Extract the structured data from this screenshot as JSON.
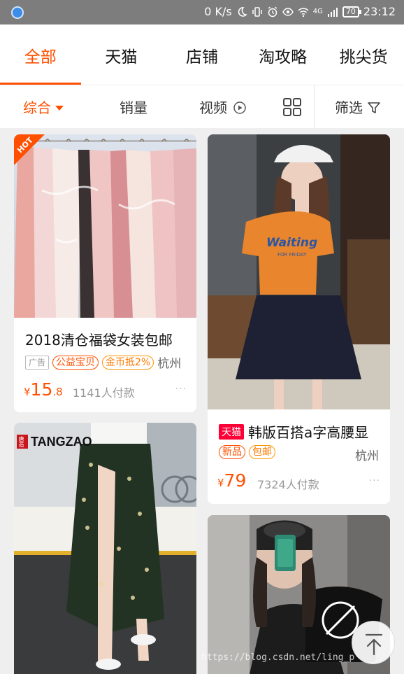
{
  "status_bar": {
    "network_speed": "0 K/s",
    "signal_label": "4G",
    "battery": "70",
    "time": "23:12"
  },
  "tabs": [
    {
      "label": "全部",
      "active": true
    },
    {
      "label": "天猫",
      "active": false
    },
    {
      "label": "店铺",
      "active": false
    },
    {
      "label": "淘攻略",
      "active": false
    },
    {
      "label": "挑尖货",
      "active": false
    }
  ],
  "sort_bar": {
    "comprehensive": "综合",
    "sales": "销量",
    "video": "视频",
    "filter": "筛选"
  },
  "products": [
    {
      "badge": "HOT",
      "title": "2018清仓福袋女装包邮",
      "ad_label": "广告",
      "tags": [
        "公益宝贝",
        "金币抵2%"
      ],
      "location": "杭州",
      "price_symbol": "¥",
      "price_int": "15",
      "price_dec": ".8",
      "sales": "1141人付款",
      "more": "···"
    },
    {
      "shirt_text": "Waiting",
      "shirt_subtext": "FOR FRIDAY",
      "tmall_badge": "天猫",
      "title": "韩版百搭a字高腰显",
      "tags": [
        "新品",
        "包邮"
      ],
      "location": "杭州",
      "price_symbol": "¥",
      "price_int": "79",
      "sales": "7324人付款",
      "more": "···"
    },
    {
      "brand_mark": "唐造",
      "brand_name": "TANGZAO"
    },
    {}
  ],
  "watermark": "https://blog.csdn.net/ling_p",
  "colors": {
    "accent": "#ff5000",
    "tmall": "#ff0036"
  }
}
